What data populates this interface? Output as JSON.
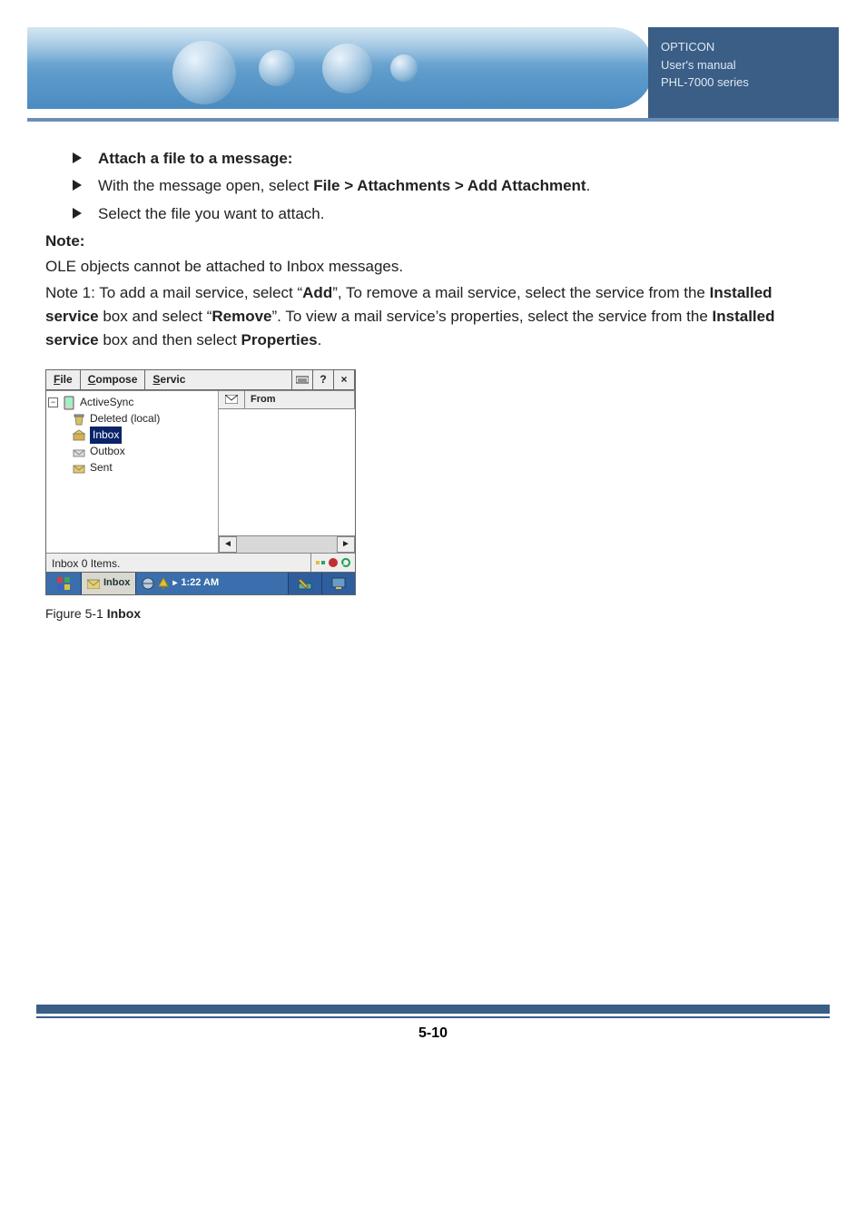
{
  "header": {
    "brand": "OPTICON",
    "line2": "User's manual",
    "line3": "PHL-7000 series"
  },
  "body": {
    "bullets": {
      "b1_bold": "Attach a file to a message:",
      "b2_pre": "With the message open, select ",
      "b2_bold": "File > Attachments > Add Attachment",
      "b2_post": ".",
      "b3": "Select the file you want to attach."
    },
    "note_label": "Note:",
    "note_line": "OLE objects cannot be attached to Inbox messages.",
    "n1_pre": "Note 1: To add a mail service, select “",
    "n1_b1": "Add",
    "n1_mid1": "”, To remove a mail service, select the service from the ",
    "n1_b2": "Installed service",
    "n1_mid2": " box and select “",
    "n1_b3": "Remove",
    "n1_mid3": "”. To view a mail service’s properties, select the service from the ",
    "n1_b4": "Installed service",
    "n1_mid4": " box and then select ",
    "n1_b5": "Properties",
    "n1_post": "."
  },
  "shot": {
    "menu": {
      "file": "File",
      "compose": "Compose",
      "service": "Servic",
      "help": "?",
      "close": "×"
    },
    "tree": {
      "root": "ActiveSync",
      "deleted": "Deleted (local)",
      "inbox": "Inbox",
      "outbox": "Outbox",
      "sent": "Sent"
    },
    "list": {
      "col_from": "From"
    },
    "status": "Inbox 0 Items.",
    "task": {
      "app": "Inbox",
      "time": "1:22 AM"
    }
  },
  "caption_pre": "Figure 5-1 ",
  "caption_bold": "Inbox",
  "pagenum": "5-10"
}
